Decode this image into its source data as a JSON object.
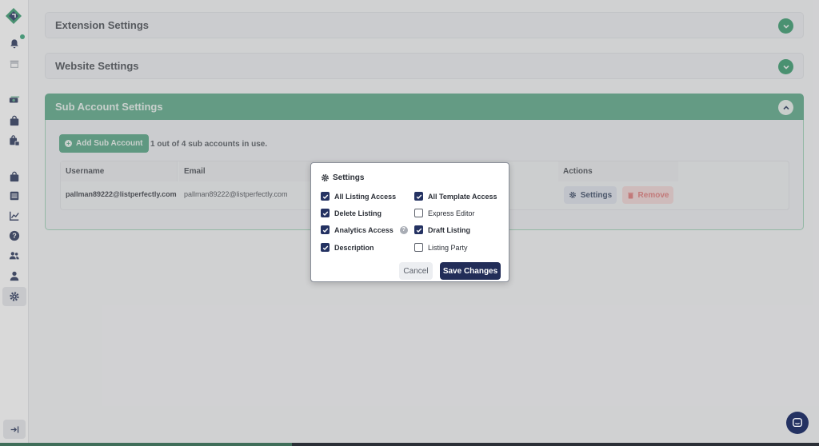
{
  "panels": {
    "extension": {
      "title": "Extension Settings"
    },
    "website": {
      "title": "Website Settings"
    },
    "sub_account": {
      "title": "Sub Account Settings",
      "add_label": "Add Sub Account",
      "usage_text": "1 out of 4 sub accounts in use.",
      "columns": [
        "Username",
        "Email",
        "Actions"
      ],
      "rows": [
        {
          "username": "pallman89222@listperfectly.com",
          "email": "pallman89222@listperfectly.com",
          "settings_label": "Settings",
          "remove_label": "Remove"
        }
      ]
    }
  },
  "modal": {
    "title": "Settings",
    "options": [
      {
        "label": "All Listing Access",
        "checked": true
      },
      {
        "label": "All Template Access",
        "checked": true
      },
      {
        "label": "Delete Listing",
        "checked": true
      },
      {
        "label": "Express Editor",
        "checked": false
      },
      {
        "label": "Analytics Access",
        "checked": true,
        "help": true
      },
      {
        "label": "Draft Listing",
        "checked": true
      },
      {
        "label": "Description",
        "checked": true
      },
      {
        "label": "Listing Party",
        "checked": false
      }
    ],
    "cancel_label": "Cancel",
    "save_label": "Save Changes"
  },
  "colors": {
    "accent_green": "#3a9c70",
    "primary_navy": "#222d58",
    "danger": "#e07b7b"
  },
  "icons": {
    "sidebar": [
      "logo-icon",
      "bell-icon",
      "store-icon",
      "money-icon",
      "bag-icon",
      "bag-lock-icon",
      "shopping-bag-icon",
      "list-icon",
      "chart-icon",
      "help-icon",
      "users-icon",
      "user-icon",
      "gear-icon",
      "collapse-icon"
    ]
  }
}
